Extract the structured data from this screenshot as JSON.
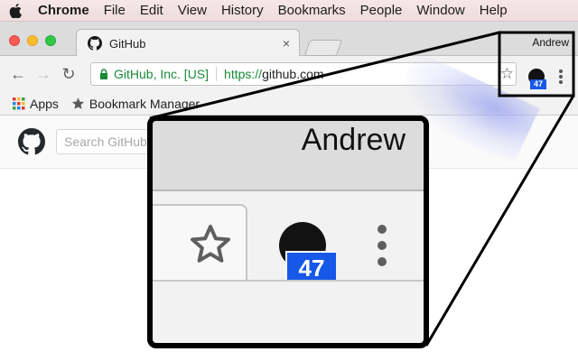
{
  "menubar": {
    "apple_icon": "apple-logo-icon",
    "items": [
      {
        "label": "Chrome",
        "bold": true
      },
      {
        "label": "File"
      },
      {
        "label": "Edit"
      },
      {
        "label": "View"
      },
      {
        "label": "History"
      },
      {
        "label": "Bookmarks"
      },
      {
        "label": "People"
      },
      {
        "label": "Window"
      },
      {
        "label": "Help"
      }
    ]
  },
  "window": {
    "controls": [
      "close",
      "minimize",
      "zoom"
    ]
  },
  "tab": {
    "title": "GitHub",
    "favicon": "github-icon",
    "close_label": "×"
  },
  "profile": {
    "name": "Andrew"
  },
  "toolbar": {
    "back_label": "←",
    "forward_label": "→",
    "reload_label": "↻",
    "secure_label": "GitHub, Inc. [US]",
    "url_scheme": "https://",
    "url_host": "github.com",
    "bookmark_star": "☆",
    "extension_badge": "47"
  },
  "bookmarks_bar": {
    "items": [
      {
        "label": "Apps",
        "icon": "apps-grid-icon"
      },
      {
        "label": "Bookmark Manager",
        "icon": "star-icon"
      }
    ]
  },
  "page": {
    "search_placeholder": "Search GitHub"
  },
  "zoom_callout": {
    "profile_name": "Andrew",
    "extension_badge": "47"
  },
  "colors": {
    "secure_green": "#198a37",
    "badge_blue": "#1758e8"
  }
}
